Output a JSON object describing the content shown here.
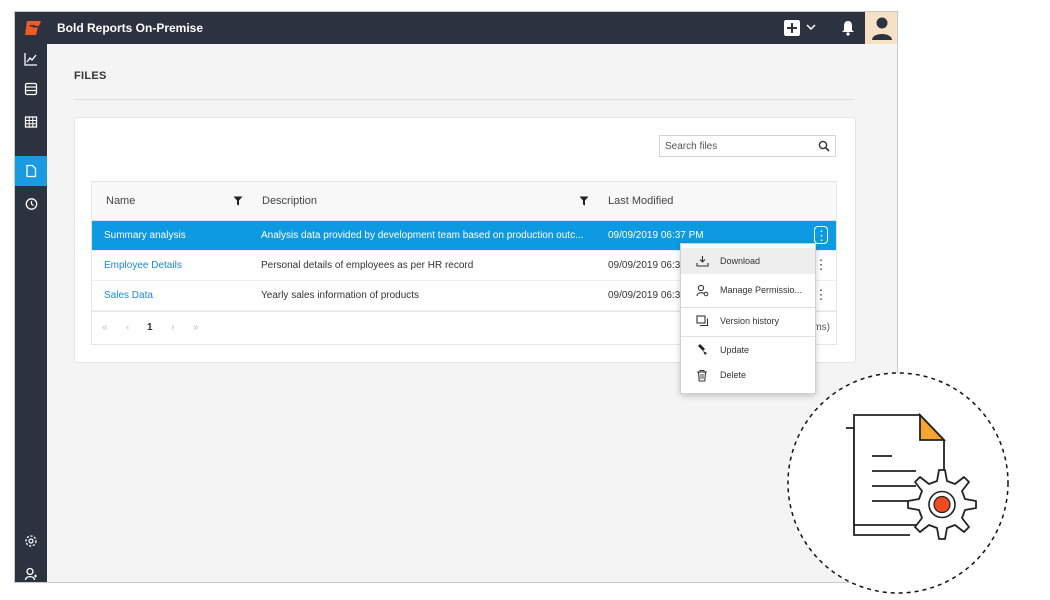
{
  "app": {
    "title": "Bold Reports On-Premise"
  },
  "page": {
    "title": "FILES"
  },
  "search": {
    "placeholder": "Search files"
  },
  "table": {
    "headers": {
      "name": "Name",
      "description": "Description",
      "modified": "Last Modified"
    },
    "rows": [
      {
        "name": "Summary analysis",
        "description": "Analysis data provided by development team based on production outc...",
        "modified": "09/09/2019 06:37 PM",
        "selected": true
      },
      {
        "name": "Employee Details",
        "description": "Personal details of employees as per HR record",
        "modified": "09/09/2019 06:3",
        "selected": false
      },
      {
        "name": "Sales Data",
        "description": "Yearly sales information of products",
        "modified": "09/09/2019 06:3",
        "selected": false
      }
    ]
  },
  "pager": {
    "first": "«",
    "prev": "‹",
    "page": "1",
    "next": "›",
    "last": "»",
    "info": "ms)"
  },
  "context_menu": {
    "items": [
      {
        "label": "Download",
        "icon": "download-icon"
      },
      {
        "label": "Manage Permissio...",
        "icon": "manage-permission-icon"
      },
      {
        "label": "Version history",
        "icon": "version-history-icon"
      },
      {
        "label": "Update",
        "icon": "update-icon"
      },
      {
        "label": "Delete",
        "icon": "delete-icon"
      }
    ]
  },
  "colors": {
    "topbar": "#2d3240",
    "accent": "#0e9ae2",
    "logo": "#f15a24"
  }
}
